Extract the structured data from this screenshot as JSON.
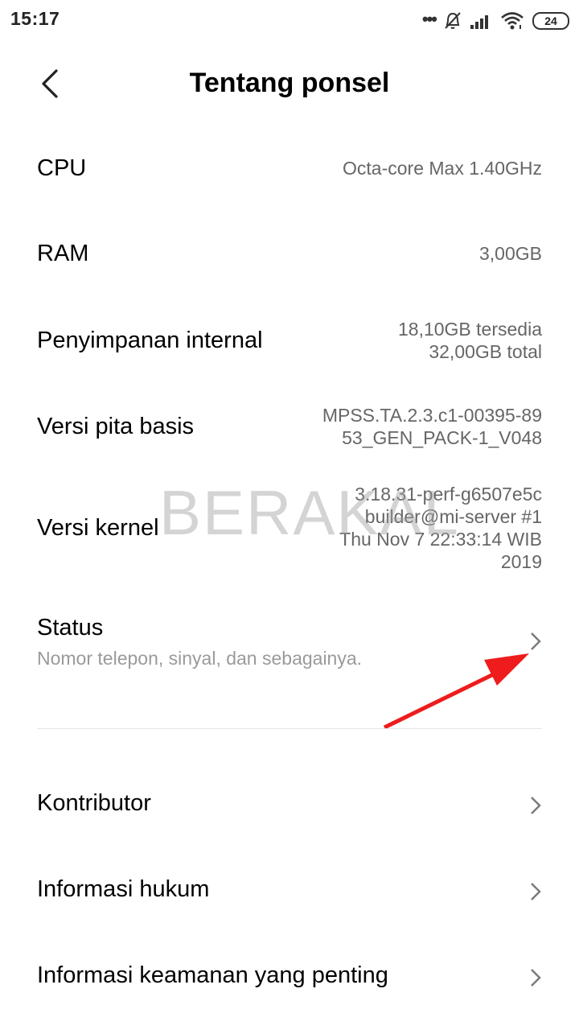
{
  "status_bar": {
    "time": "15:17",
    "battery": "24",
    "icons": [
      "more-dots-icon",
      "bell-off-icon",
      "signal-icon",
      "wifi-icon",
      "battery-icon"
    ]
  },
  "header": {
    "title": "Tentang ponsel",
    "back_icon": "chevron-left-icon"
  },
  "specs": [
    {
      "label": "CPU",
      "value": [
        "Octa-core Max 1.40GHz"
      ]
    },
    {
      "label": "RAM",
      "value": [
        "3,00GB"
      ]
    },
    {
      "label": "Penyimpanan internal",
      "value": [
        "18,10GB tersedia",
        "32,00GB total"
      ]
    },
    {
      "label": "Versi pita basis",
      "value": [
        "MPSS.TA.2.3.c1-00395-89",
        "53_GEN_PACK-1_V048"
      ]
    },
    {
      "label": "Versi kernel",
      "value": [
        "3.18.31-perf-g6507e5c",
        "builder@mi-server #1",
        "Thu Nov 7 22:33:14 WIB",
        "2019"
      ]
    }
  ],
  "status_item": {
    "label": "Status",
    "subtitle": "Nomor telepon, sinyal, dan sebagainya."
  },
  "nav_items": [
    {
      "label": "Kontributor"
    },
    {
      "label": "Informasi hukum"
    },
    {
      "label": "Informasi keamanan yang penting"
    }
  ],
  "watermark": "BERAKAL",
  "annotation": {
    "arrow_color": "#ee1c1c"
  }
}
